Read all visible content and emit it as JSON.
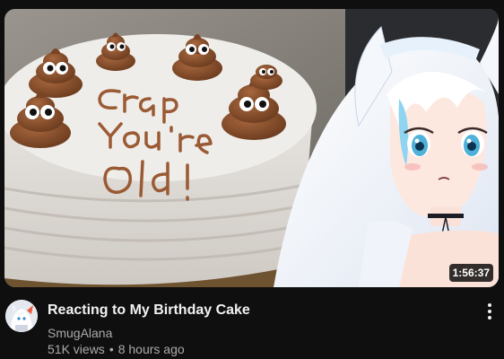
{
  "video": {
    "duration": "1:56:37",
    "title": "Reacting to My Birthday Cake",
    "channel": "SmugAlana",
    "views": "51K views",
    "separator": "•",
    "age": "8 hours ago"
  },
  "thumbnail": {
    "cake_text": [
      "Crap",
      "You're",
      "Old!"
    ]
  },
  "icons": {
    "more": "more-vert-icon",
    "avatar": "channel-avatar"
  },
  "colors": {
    "background": "#0f0f0f",
    "title": "#f1f1f1",
    "secondary": "#aaaaaa",
    "frosting_brown": "#8a5230"
  }
}
